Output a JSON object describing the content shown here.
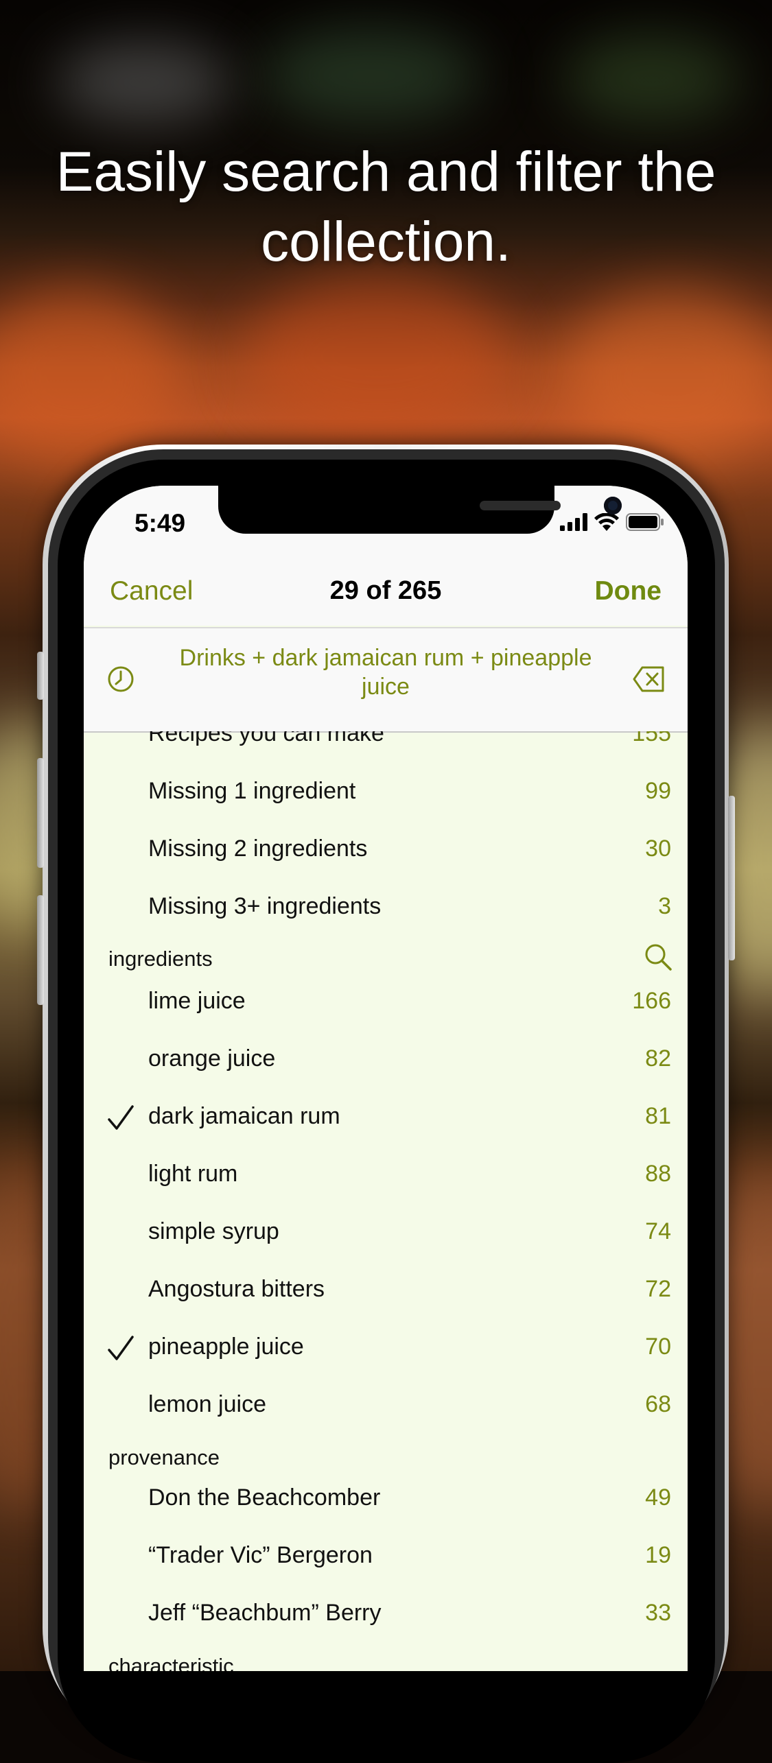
{
  "headline": "Easily search and filter the collection.",
  "status": {
    "time": "5:49"
  },
  "nav": {
    "cancel": "Cancel",
    "title": "29 of 265",
    "done": "Done"
  },
  "filter": {
    "text": "Drinks + dark jamaican rum + pineapple juice"
  },
  "list": {
    "partial_row": {
      "label": "Recipes you can make",
      "count": "155"
    },
    "availability": [
      {
        "label": "Missing 1 ingredient",
        "count": "99"
      },
      {
        "label": "Missing 2 ingredients",
        "count": "30"
      },
      {
        "label": "Missing 3+ ingredients",
        "count": "3"
      }
    ],
    "ingredients_header": "ingredients",
    "ingredients": [
      {
        "label": "lime juice",
        "count": "166",
        "checked": false
      },
      {
        "label": "orange juice",
        "count": "82",
        "checked": false
      },
      {
        "label": "dark jamaican rum",
        "count": "81",
        "checked": true
      },
      {
        "label": "light rum",
        "count": "88",
        "checked": false
      },
      {
        "label": "simple syrup",
        "count": "74",
        "checked": false
      },
      {
        "label": "Angostura bitters",
        "count": "72",
        "checked": false
      },
      {
        "label": "pineapple juice",
        "count": "70",
        "checked": true
      },
      {
        "label": "lemon juice",
        "count": "68",
        "checked": false
      }
    ],
    "provenance_header": "provenance",
    "provenance": [
      {
        "label": "Don the Beachcomber",
        "count": "49"
      },
      {
        "label": "“Trader Vic” Bergeron",
        "count": "19"
      },
      {
        "label": "Jeff “Beachbum” Berry",
        "count": "33"
      }
    ],
    "characteristic_header": "characteristic"
  },
  "colors": {
    "accent": "#7b8a14",
    "list_bg": "#f5fbe8",
    "bar_bg": "#f9f9f9"
  },
  "icons": [
    "clock-icon",
    "clear-filter-icon",
    "search-icon",
    "checkmark-icon",
    "signal-icon",
    "wifi-icon",
    "battery-icon"
  ]
}
